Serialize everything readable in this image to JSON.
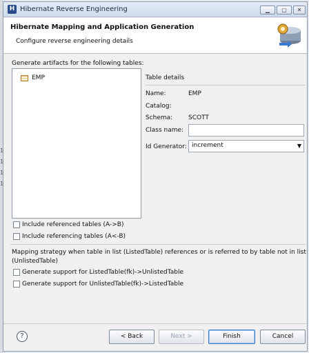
{
  "window": {
    "title": "Hibernate Reverse Engineering"
  },
  "header": {
    "title": "Hibernate Mapping and Application Generation",
    "subtitle": "Configure reverse engineering details"
  },
  "tables": {
    "label": "Generate artifacts for the following tables:",
    "items": [
      "EMP"
    ]
  },
  "details": {
    "title": "Table details",
    "name_label": "Name:",
    "name_value": "EMP",
    "catalog_label": "Catalog:",
    "catalog_value": "",
    "schema_label": "Schema:",
    "schema_value": "SCOTT",
    "classname_label": "Class name:",
    "classname_value": "",
    "idgen_label": "Id Generator:",
    "idgen_value": "increment"
  },
  "options": {
    "include_referenced": "Include referenced tables (A->B)",
    "include_referencing": "Include referencing tables (A<-B)",
    "strategy_text_1": "Mapping strategy when table in list (ListedTable) references or is referred to by table not in list",
    "strategy_text_2": "(UnlistedTable)",
    "support_listed": "Generate support for ListedTable(fk)->UnlistedTable",
    "support_unlisted": "Generate support for UnlistedTable(fk)->ListedTable"
  },
  "buttons": {
    "back": "< Back",
    "next": "Next >",
    "finish": "Finish",
    "cancel": "Cancel"
  },
  "background": {
    "line_numbers": [
      "1",
      "1",
      "1",
      "1"
    ]
  }
}
